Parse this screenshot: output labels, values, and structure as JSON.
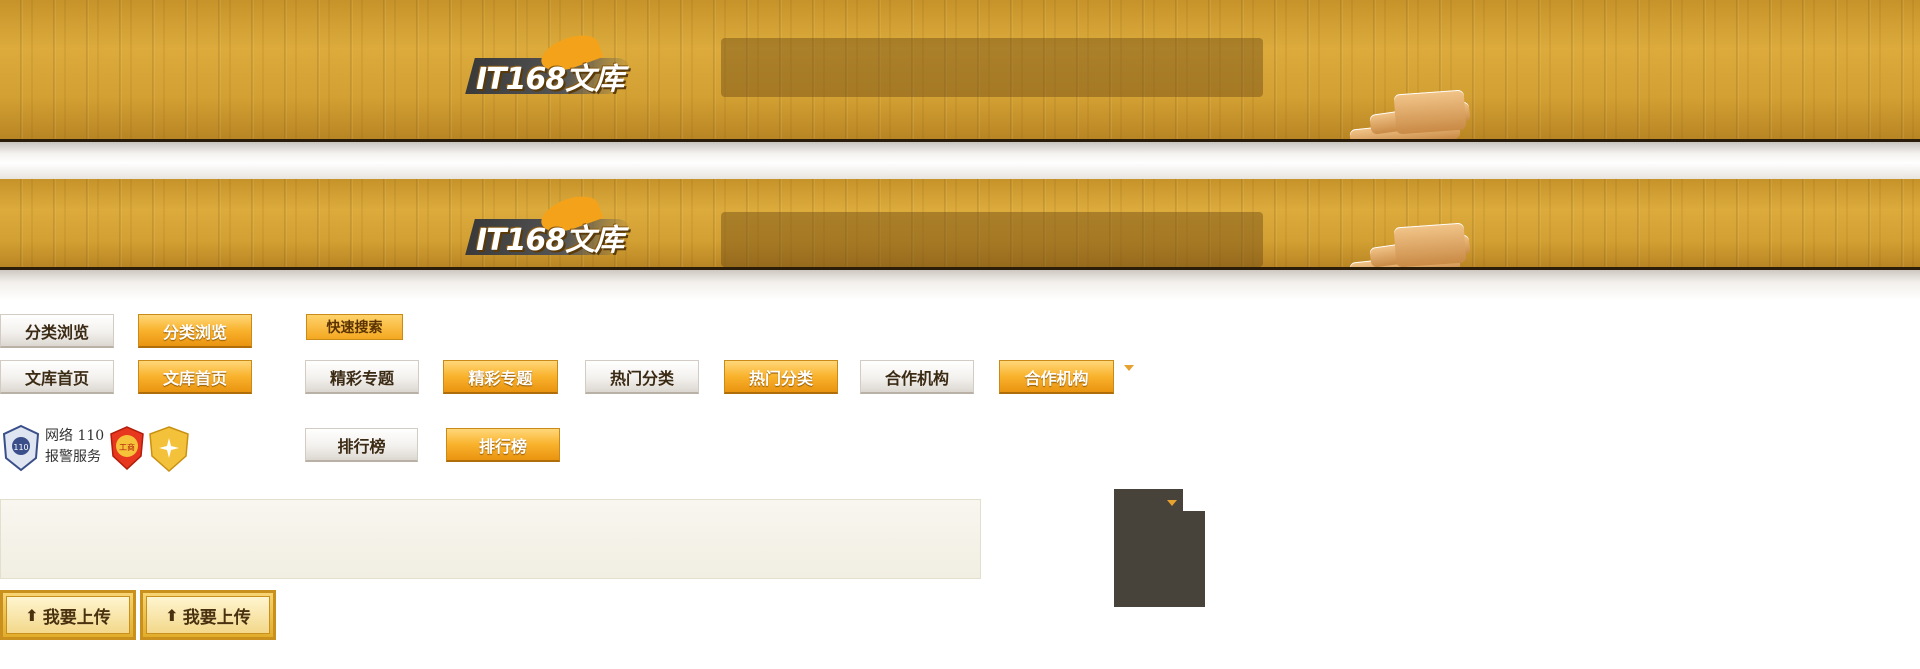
{
  "header": {
    "logo_text": "IT168文库",
    "search_placeholder": ""
  },
  "nav": {
    "browse_categories": "分类浏览",
    "library_home": "文库首页",
    "quick_search": "快速搜索",
    "featured_topics": "精彩专题",
    "hot_categories": "热门分类",
    "partners": "合作机构",
    "ranking": "排行榜"
  },
  "badges": {
    "police_service_line1": "网络 110",
    "police_service_line2": "报警服务",
    "shield_text": "工商"
  },
  "upload": {
    "label": "我要上传"
  },
  "colors": {
    "wood": "#d3a033",
    "accent_orange": "#f9b22c",
    "dark_popup": "#47423a"
  }
}
